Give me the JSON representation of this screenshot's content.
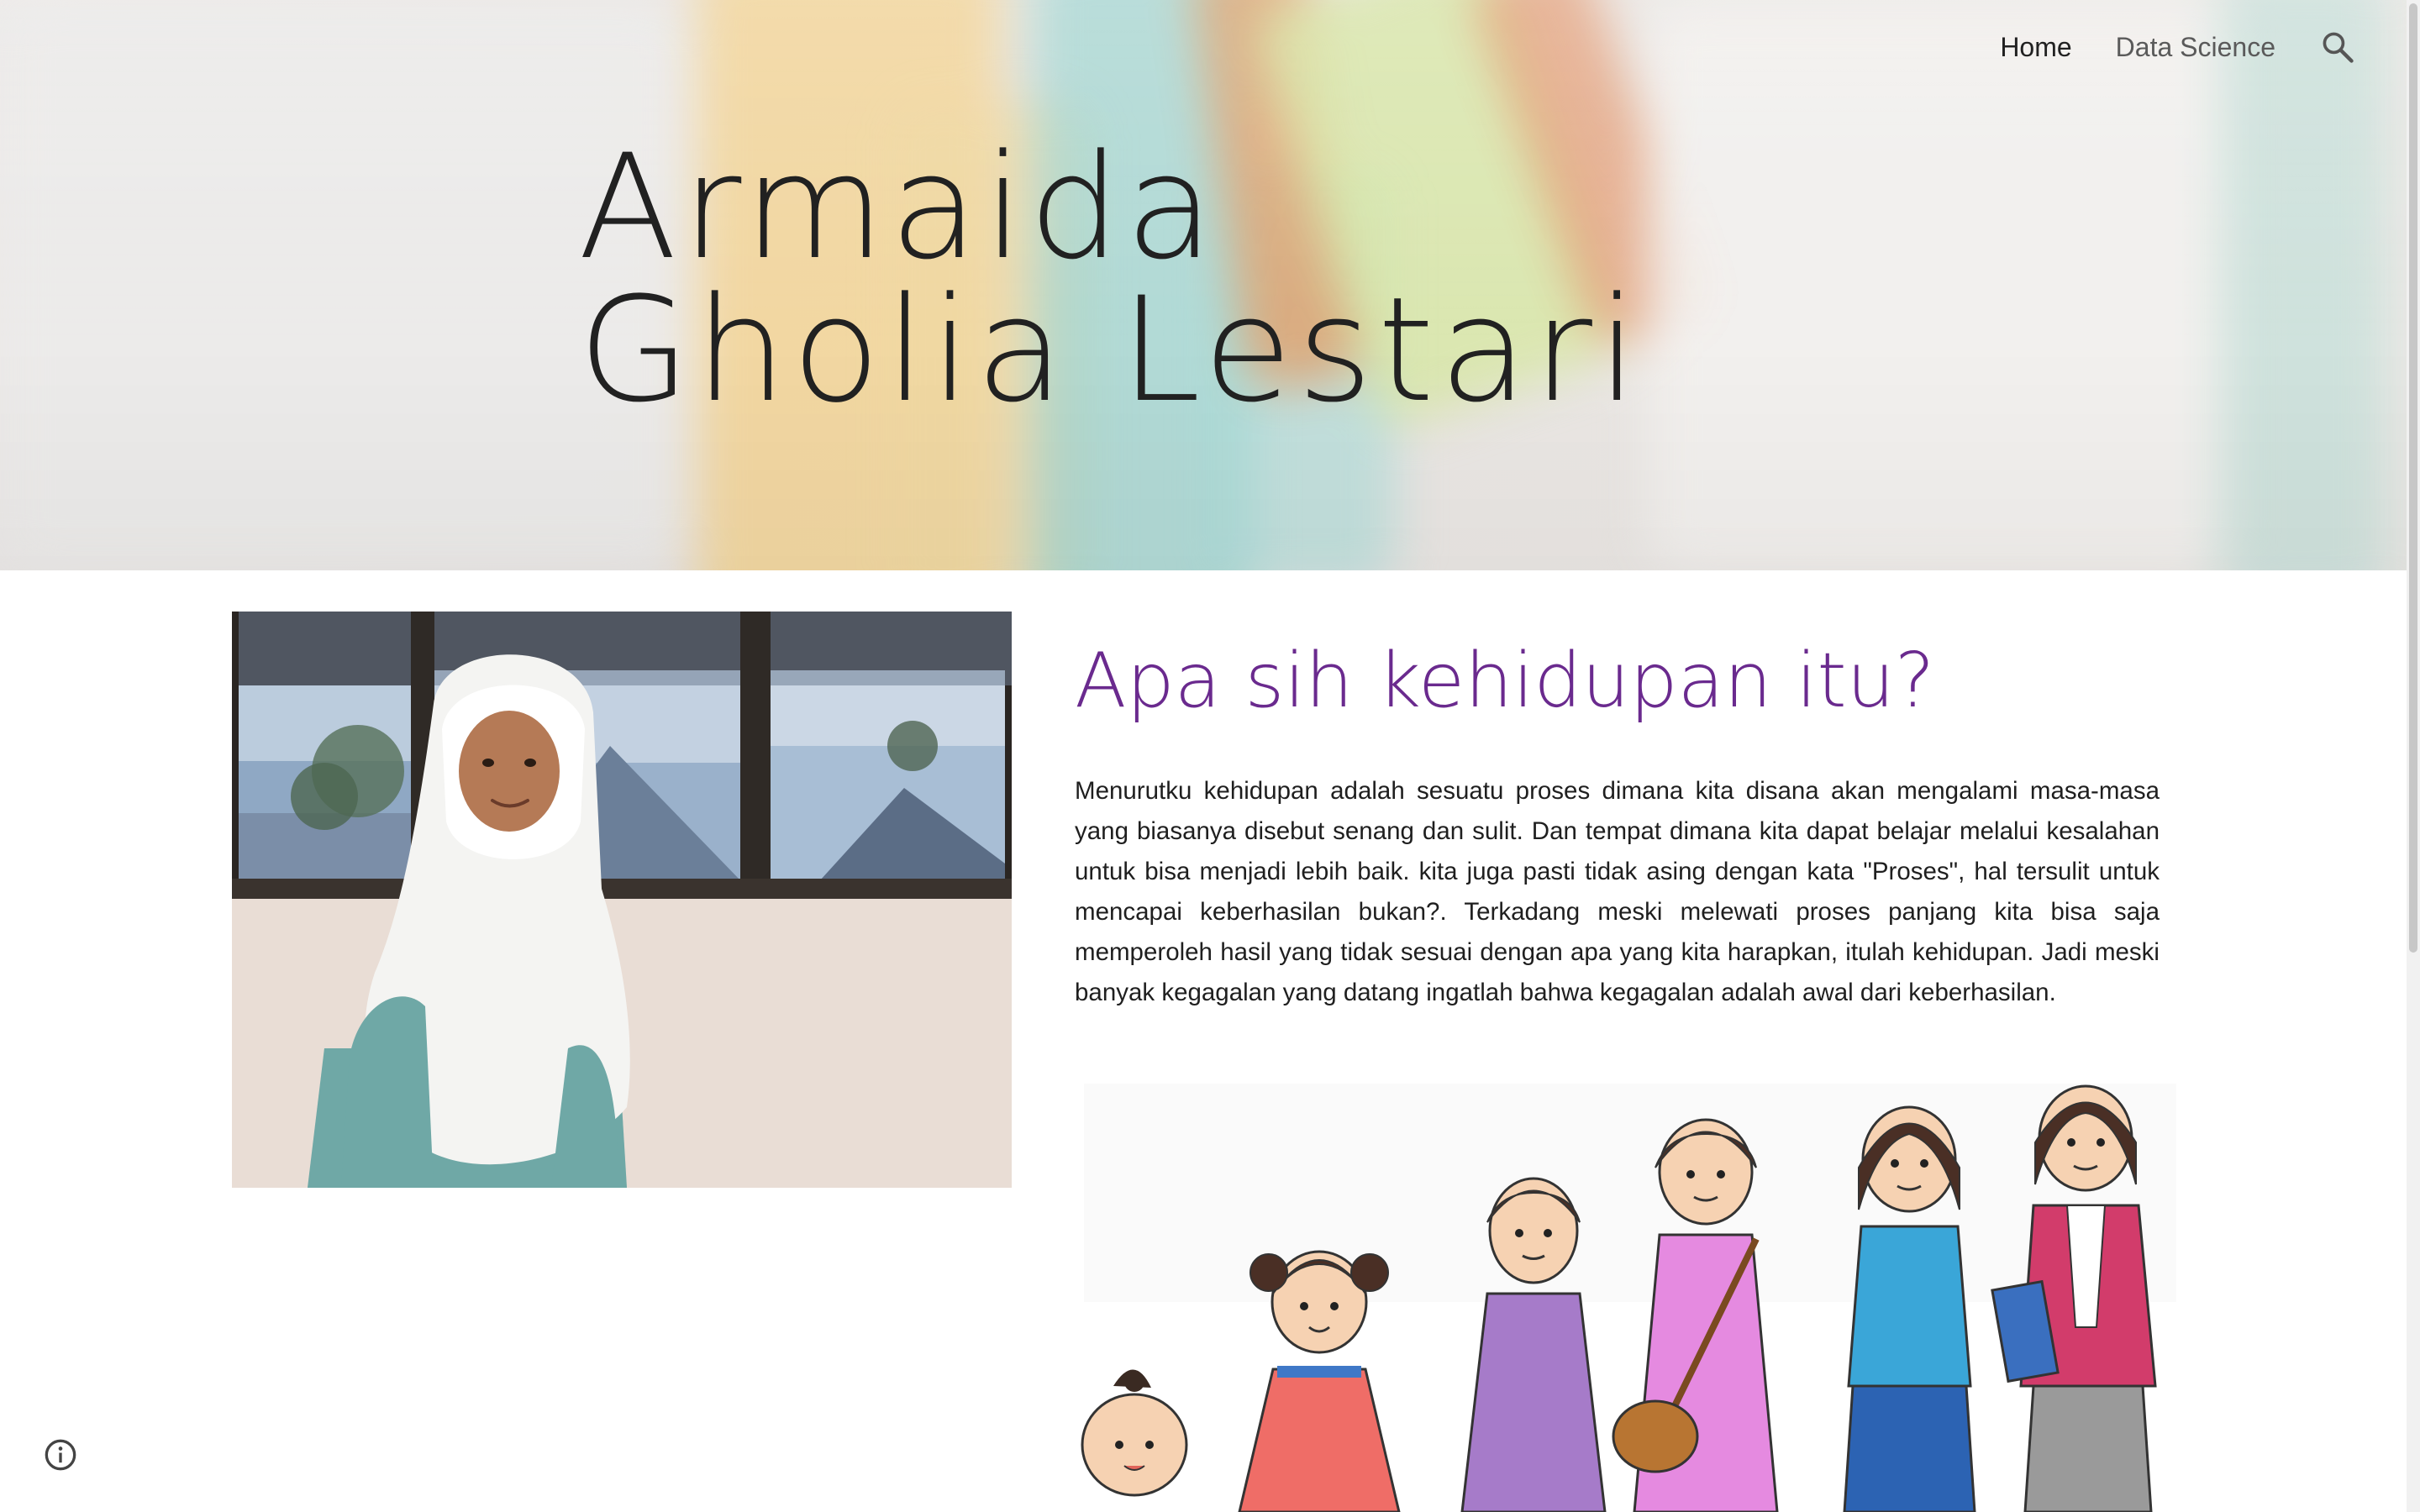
{
  "site": {
    "title": "Armaida Gholia Lestari"
  },
  "nav": {
    "items": [
      {
        "label": "Home",
        "active": true
      },
      {
        "label": "Data Science",
        "active": false
      }
    ],
    "search_icon": "search-icon"
  },
  "main": {
    "heading": "Apa sih kehidupan itu?",
    "paragraph": "Menurutku kehidupan adalah sesuatu proses dimana kita disana akan mengalami masa-masa yang biasanya disebut senang dan sulit. Dan tempat dimana kita dapat belajar melalui kesalahan untuk bisa menjadi lebih baik. kita juga pasti tidak asing dengan kata \"Proses\", hal tersulit untuk mencapai keberhasilan bukan?. Terkadang meski melewati proses panjang kita bisa saja memperoleh hasil yang tidak sesuai dengan apa yang kita harapkan, itulah kehidupan. Jadi meski banyak kegagalan yang datang ingatlah bahwa kegagalan adalah awal dari keberhasilan."
  },
  "footer": {
    "info_icon": "info-icon"
  },
  "colors": {
    "heading_accent": "#6a2a8e",
    "title_text": "#212121",
    "nav_active": "#212121",
    "nav_inactive": "#5a5a5a"
  }
}
